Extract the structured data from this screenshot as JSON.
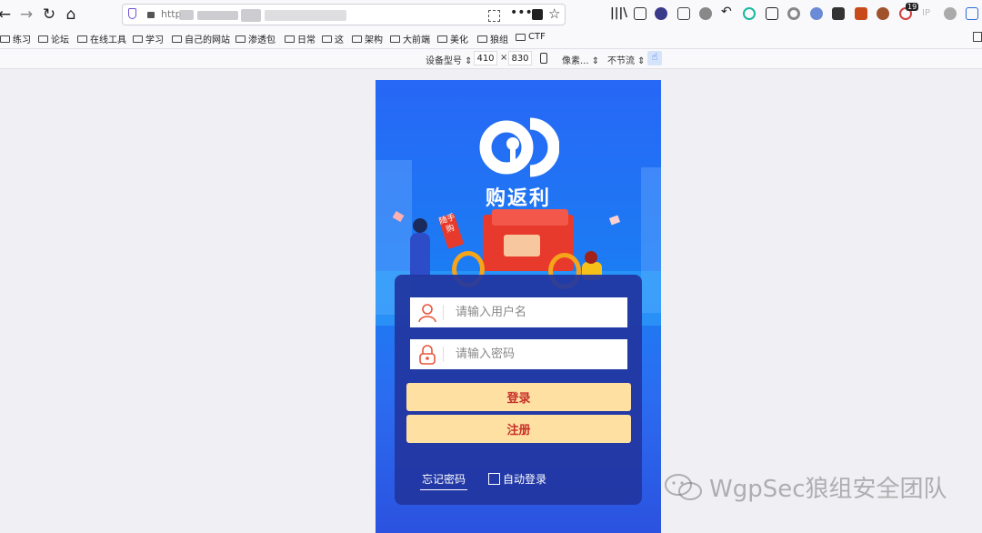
{
  "browser": {
    "url": "http",
    "bookmarks": [
      "练习",
      "论坛",
      "在线工具",
      "学习",
      "自己的网站",
      "渗透包",
      "日常",
      "这",
      "架构",
      "大前端",
      "美化",
      "狼组",
      "CTF"
    ],
    "extension_badge": "19",
    "ip_label": "IP"
  },
  "responsive": {
    "device_label": "设备型号",
    "width": "410",
    "times": "×",
    "height": "830",
    "pixel_label": "像素...",
    "throttle_label": "不节流"
  },
  "app": {
    "logo_text": "购返利",
    "badge_text": "随手购",
    "username_placeholder": "请输入用户名",
    "password_placeholder": "请输入密码",
    "login_label": "登录",
    "register_label": "注册",
    "forgot_label": "忘记密码",
    "auto_login_label": "自动登录"
  },
  "watermark": "WgpSec狼组安全团队",
  "colors": {
    "accent": "#c8302a",
    "button": "#fde0a2",
    "phone_bg": "#1b7ef4"
  }
}
